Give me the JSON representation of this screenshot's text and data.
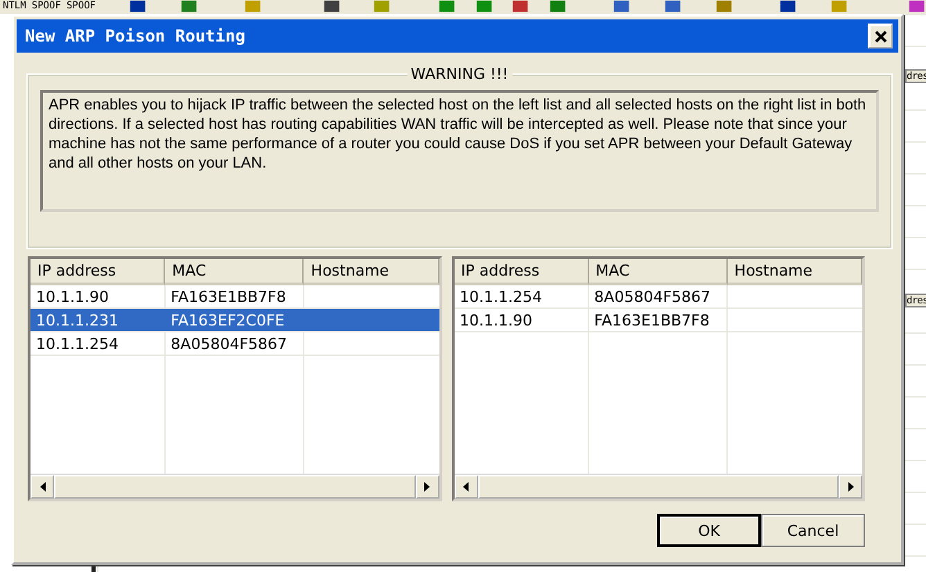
{
  "toolbar": {
    "labels": [
      "NTLM",
      "SPOOF",
      "SPOOF"
    ]
  },
  "background_headers": [
    "dres",
    "dres"
  ],
  "dialog": {
    "title": "New ARP Poison Routing",
    "warning": {
      "title": "WARNING !!!",
      "text": "APR enables you to hijack IP traffic between the selected host on the left list and all selected hosts on the right list in both directions. If a selected host has routing capabilities WAN traffic will be intercepted as well. Please note that since your machine has not the same performance of a router you could cause DoS if you set APR between your Default Gateway and all other hosts on your LAN."
    },
    "lists": [
      {
        "columns": [
          "IP address",
          "MAC",
          "Hostname"
        ],
        "rows": [
          {
            "ip": "10.1.1.90",
            "mac": "FA163E1BB7F8",
            "selected": false
          },
          {
            "ip": "10.1.1.231",
            "mac": "FA163EF2C0FE",
            "selected": true
          },
          {
            "ip": "10.1.1.254",
            "mac": "8A05804F5867",
            "selected": false
          }
        ]
      },
      {
        "columns": [
          "IP address",
          "MAC",
          "Hostname"
        ],
        "rows": [
          {
            "ip": "10.1.1.254",
            "mac": "8A05804F5867",
            "selected": false
          },
          {
            "ip": "10.1.1.90",
            "mac": "FA163E1BB7F8",
            "selected": false
          }
        ]
      }
    ],
    "buttons": [
      {
        "label": "OK",
        "default": true
      },
      {
        "label": "Cancel",
        "default": false
      }
    ]
  }
}
